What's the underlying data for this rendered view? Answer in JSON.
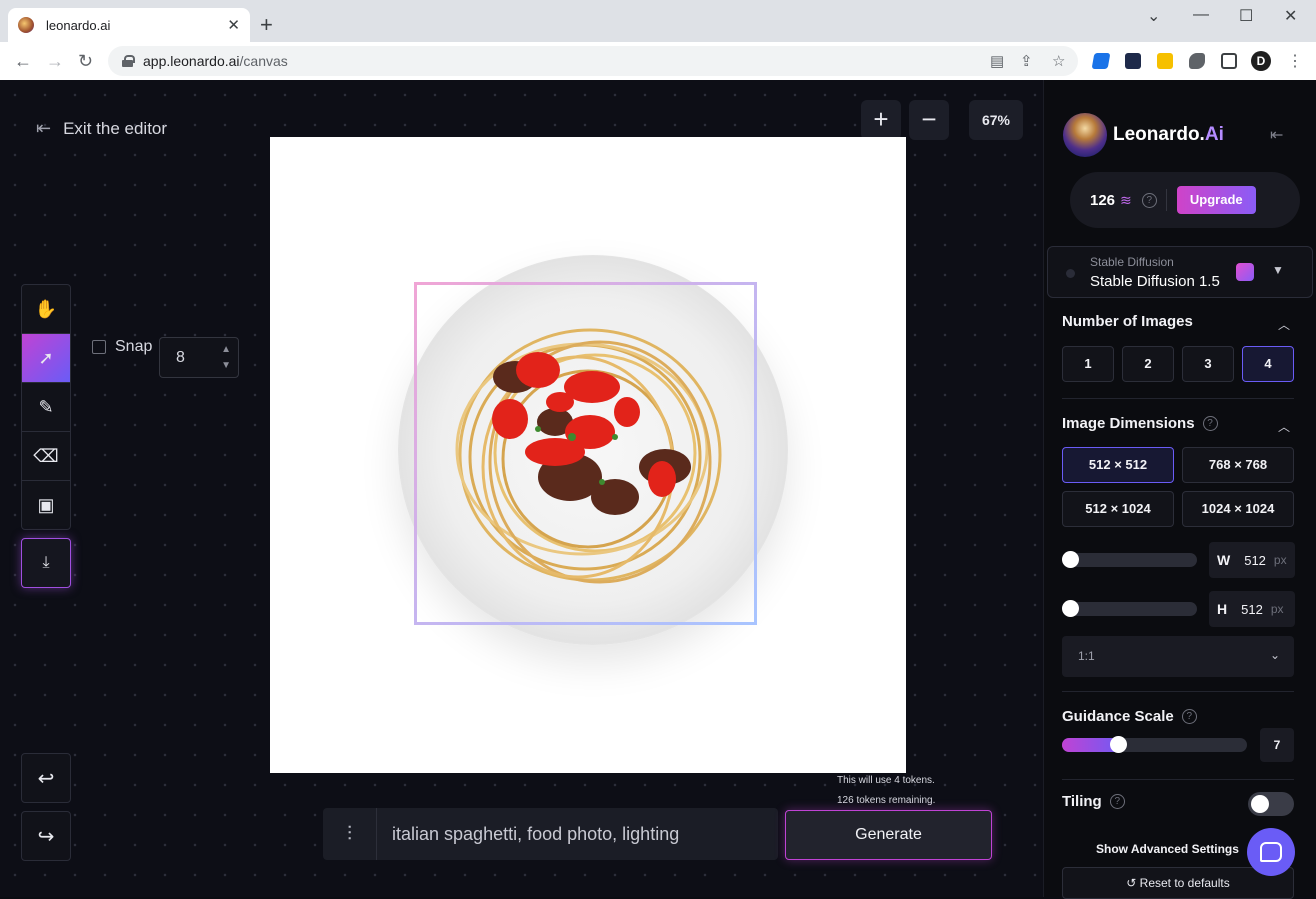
{
  "browser": {
    "tab_title": "leonardo.ai",
    "tab_close": "✕",
    "new_tab": "+",
    "url_domain": "app.leonardo.ai",
    "url_path": "/canvas",
    "minimize": "⌄",
    "window_min": "—",
    "window_max": "☐",
    "window_close": "✕",
    "avatar_letter": "D"
  },
  "editor": {
    "exit_label": "Exit the editor",
    "zoom_in": "+",
    "zoom_out": "−",
    "zoom_level": "67%",
    "snap_label": "Snap",
    "snap_value": "8",
    "tokens_use": "This will use 4 tokens.",
    "tokens_remaining": "126 tokens remaining.",
    "prompt_text": "italian spaghetti, food photo, lighting",
    "generate_label": "Generate",
    "tools": [
      "hand-icon",
      "select-icon",
      "brush-icon",
      "eraser-icon",
      "image-icon"
    ],
    "active_tool": "select-icon"
  },
  "panel": {
    "brand_name": "Leonardo.",
    "brand_suffix": "Ai",
    "credits": "126",
    "upgrade_label": "Upgrade",
    "model_family": "Stable Diffusion",
    "model_name": "Stable Diffusion 1.5",
    "num_images_title": "Number of Images",
    "num_images_options": [
      "1",
      "2",
      "3",
      "4"
    ],
    "num_images_selected": "4",
    "dimensions_title": "Image Dimensions",
    "dimension_options": [
      "512 × 512",
      "768 × 768",
      "512 × 1024",
      "1024 × 1024"
    ],
    "dimension_selected": "512 × 512",
    "width_key": "W",
    "width_value": "512",
    "height_key": "H",
    "height_value": "512",
    "unit": "px",
    "width_slider_level": 0,
    "height_slider_level": 0,
    "aspect_ratio": "1:1",
    "guidance_title": "Guidance Scale",
    "guidance_value": "7",
    "guidance_level": 0.3,
    "tiling_title": "Tiling",
    "tiling_on": false,
    "advanced_label": "Show Advanced Settings",
    "reset_label": "Reset to defaults"
  },
  "colors": {
    "accent_pink": "#c043d4",
    "accent_purple": "#6a5cf6",
    "brand_ai": "#b58cff",
    "bg": "#0d0e16"
  }
}
